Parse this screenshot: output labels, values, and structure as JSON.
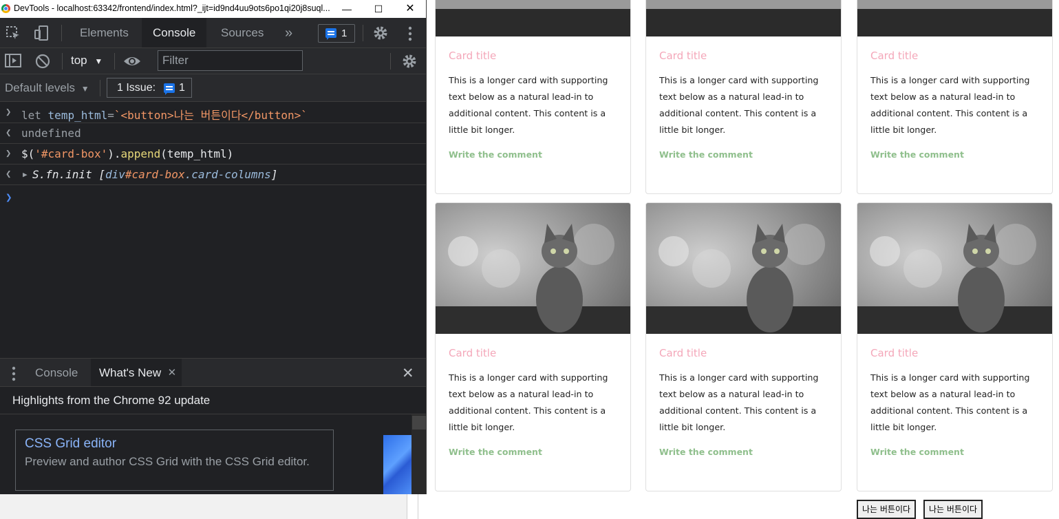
{
  "devtools": {
    "window_title": "DevTools - localhost:63342/frontend/index.html?_ijt=id9nd4uu9ots6po1qi20j8suql...",
    "window_controls": {
      "minimize": "—",
      "maximize": "☐",
      "close": "✕"
    },
    "main_tabs": [
      {
        "label": "Elements",
        "active": false
      },
      {
        "label": "Console",
        "active": true
      },
      {
        "label": "Sources",
        "active": false
      }
    ],
    "more_tabs_label": "»",
    "issues_count": "1",
    "context_select": "top",
    "filter_placeholder": "Filter",
    "levels_label": "Default levels",
    "issue_button_label": "1 Issue:",
    "issue_button_count": "1",
    "console": {
      "line1": {
        "kw": "let",
        "var": "temp_html",
        "eq": "=",
        "str": "`<button>나는 버튼이다</button>`"
      },
      "line2": {
        "result": "undefined"
      },
      "line3": {
        "dollar": "$(",
        "sel": "'#card-box'",
        "close": ").",
        "fn": "append",
        "args": "(temp_html)"
      },
      "line4": {
        "prefix": "S.fn.init [",
        "tag": "div",
        "id": "#card-box",
        "cls": ".card-columns",
        "suffix": "]"
      }
    },
    "drawer": {
      "tabs": [
        {
          "label": "Console",
          "active": false
        },
        {
          "label": "What's New",
          "active": true
        }
      ],
      "heading": "Highlights from the Chrome 92 update",
      "feature_title": "CSS Grid editor",
      "feature_desc": "Preview and author CSS Grid with the CSS Grid editor."
    },
    "colors": {
      "bg": "#202124",
      "toolbar": "#292a2d",
      "accent": "#1a73e8"
    }
  },
  "page": {
    "cards": [
      {
        "title": "Card title",
        "text": "This is a longer card with supporting text below as a natural lead-in to additional content. This content is a little bit longer.",
        "link": "Write the comment"
      },
      {
        "title": "Card title",
        "text": "This is a longer card with supporting text below as a natural lead-in to additional content. This content is a little bit longer.",
        "link": "Write the comment"
      },
      {
        "title": "Card title",
        "text": "This is a longer card with supporting text below as a natural lead-in to additional content. This content is a little bit longer.",
        "link": "Write the comment"
      },
      {
        "title": "Card title",
        "text": "This is a longer card with supporting text below as a natural lead-in to additional content. This content is a little bit longer.",
        "link": "Write the comment"
      },
      {
        "title": "Card title",
        "text": "This is a longer card with supporting text below as a natural lead-in to additional content. This content is a little bit longer.",
        "link": "Write the comment"
      },
      {
        "title": "Card title",
        "text": "This is a longer card with supporting text below as a natural lead-in to additional content. This content is a little bit longer.",
        "link": "Write the comment"
      }
    ],
    "appended_buttons": [
      "나는 버튼이다",
      "나는 버튼이다"
    ],
    "colors": {
      "title": "#f4a7b9",
      "link": "#8fbf8c"
    }
  }
}
